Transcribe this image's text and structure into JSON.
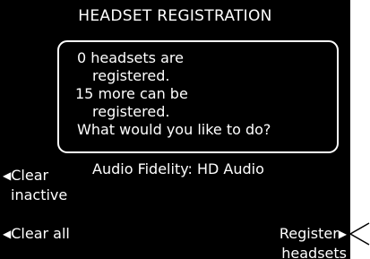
{
  "screen": {
    "title": "HEADSET REGISTRATION",
    "message": {
      "line1": "0 headsets are",
      "line2": "registered.",
      "line3": "15 more can be",
      "line4": "registered.",
      "line5": "What would you like to do?"
    },
    "audio_fidelity": "Audio Fidelity: HD Audio"
  },
  "softkeys": {
    "clear_inactive": {
      "line1": "Clear",
      "line2": "inactive",
      "arrow": "◀"
    },
    "clear_all": {
      "label": "Clear all",
      "arrow": "◀"
    },
    "register_headsets": {
      "line1": "Register",
      "line2": "headsets",
      "arrow": "▶"
    }
  },
  "icons": {
    "softkey_left": "left-triangle-icon",
    "softkey_right": "right-triangle-icon",
    "callout": "callout-pointer-icon"
  },
  "colors": {
    "screen_bg": "#000000",
    "text": "#ffffff",
    "page_bg": "#ffffff"
  }
}
